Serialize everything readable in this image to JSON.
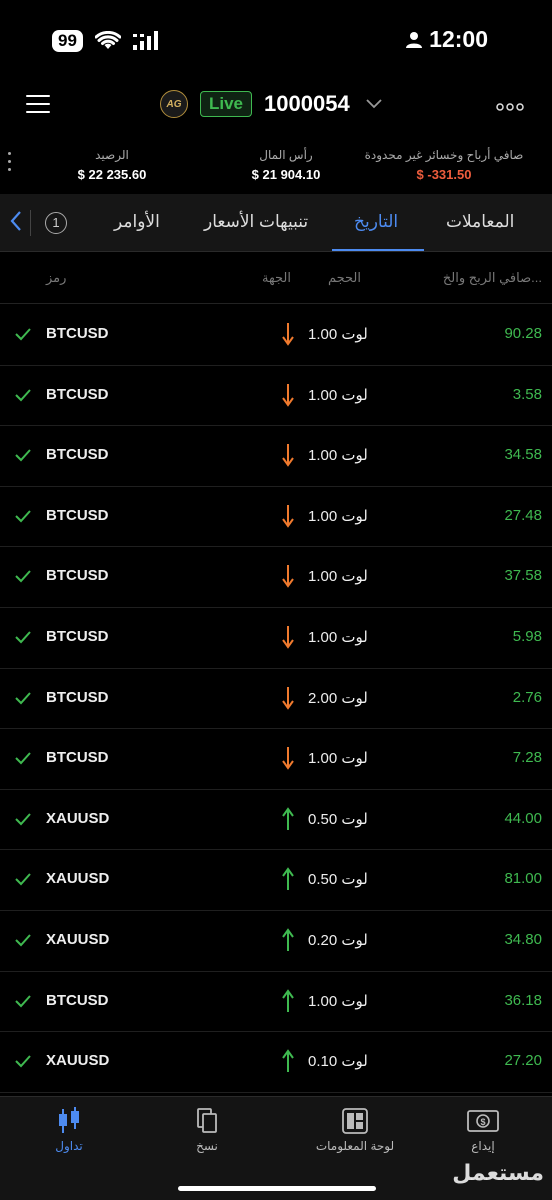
{
  "status_bar": {
    "battery": "99",
    "time": "12:00"
  },
  "header": {
    "live_label": "Live",
    "account_number": "1000054",
    "logo_text": "AG"
  },
  "summary": {
    "balance_label": "الرصيد",
    "balance_value": "$ 22 235.60",
    "capital_label": "رأس المال",
    "capital_value": "$ 21 904.10",
    "pnl_label": "صافي أرباح وخسائر غير محدودة",
    "pnl_value": "$ -331.50"
  },
  "tabs": {
    "count": "1",
    "orders": "الأوامر",
    "alerts": "تنبيهات الأسعار",
    "history": "التاريخ",
    "deals": "المعاملات"
  },
  "table_header": {
    "symbol": "رمز",
    "direction": "الجهة",
    "volume": "الحجم",
    "pnl": "صافي الربح والخ..."
  },
  "rows": [
    {
      "symbol": "BTCUSD",
      "dir": "down",
      "volume": "1.00 لوت",
      "pnl": "90.28"
    },
    {
      "symbol": "BTCUSD",
      "dir": "down",
      "volume": "1.00 لوت",
      "pnl": "3.58"
    },
    {
      "symbol": "BTCUSD",
      "dir": "down",
      "volume": "1.00 لوت",
      "pnl": "34.58"
    },
    {
      "symbol": "BTCUSD",
      "dir": "down",
      "volume": "1.00 لوت",
      "pnl": "27.48"
    },
    {
      "symbol": "BTCUSD",
      "dir": "down",
      "volume": "1.00 لوت",
      "pnl": "37.58"
    },
    {
      "symbol": "BTCUSD",
      "dir": "down",
      "volume": "1.00 لوت",
      "pnl": "5.98"
    },
    {
      "symbol": "BTCUSD",
      "dir": "down",
      "volume": "2.00 لوت",
      "pnl": "2.76"
    },
    {
      "symbol": "BTCUSD",
      "dir": "down",
      "volume": "1.00 لوت",
      "pnl": "7.28"
    },
    {
      "symbol": "XAUUSD",
      "dir": "up",
      "volume": "0.50 لوت",
      "pnl": "44.00"
    },
    {
      "symbol": "XAUUSD",
      "dir": "up",
      "volume": "0.50 لوت",
      "pnl": "81.00"
    },
    {
      "symbol": "XAUUSD",
      "dir": "up",
      "volume": "0.20 لوت",
      "pnl": "34.80"
    },
    {
      "symbol": "BTCUSD",
      "dir": "up",
      "volume": "1.00 لوت",
      "pnl": "36.18"
    },
    {
      "symbol": "XAUUSD",
      "dir": "up",
      "volume": "0.10 لوت",
      "pnl": "27.20"
    }
  ],
  "bottom_nav": {
    "trade": "تداول",
    "copy": "نسخ",
    "dashboard": "لوحة المعلومات",
    "deposit": "إيداع"
  },
  "watermark": "مستعمل",
  "colors": {
    "accent": "#4d8bf0",
    "profit": "#3fb950",
    "loss": "#ef5d3d",
    "sell_arrow": "#f07a2e",
    "buy_arrow": "#3fb950"
  }
}
